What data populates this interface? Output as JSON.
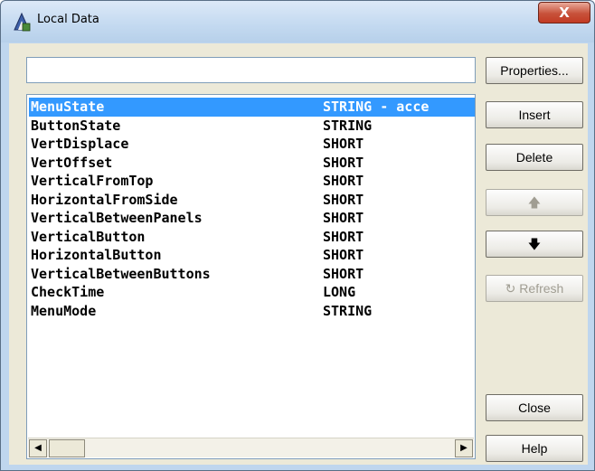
{
  "window": {
    "title": "Local Data",
    "close_label": "X"
  },
  "search": {
    "value": "",
    "placeholder": ""
  },
  "list": {
    "rows": [
      {
        "name": "MenuState",
        "type": "STRING - acce",
        "selected": true
      },
      {
        "name": "ButtonState",
        "type": "STRING"
      },
      {
        "name": "VertDisplace",
        "type": "SHORT"
      },
      {
        "name": "VertOffset",
        "type": "SHORT"
      },
      {
        "name": "VerticalFromTop",
        "type": "SHORT"
      },
      {
        "name": "HorizontalFromSide",
        "type": "SHORT"
      },
      {
        "name": "VerticalBetweenPanels",
        "type": "SHORT"
      },
      {
        "name": "VerticalButton",
        "type": "SHORT"
      },
      {
        "name": "HorizontalButton",
        "type": "SHORT"
      },
      {
        "name": "VerticalBetweenButtons",
        "type": "SHORT"
      },
      {
        "name": "CheckTime",
        "type": "LONG"
      },
      {
        "name": "MenuMode",
        "type": "STRING"
      }
    ],
    "selected_color": "#3399ff"
  },
  "scrollbar": {
    "left_icon": "triangle-left-icon",
    "right_icon": "triangle-right-icon",
    "left_glyph": "◀",
    "right_glyph": "▶"
  },
  "buttons": {
    "properties": "Properties...",
    "insert": "Insert",
    "delete": "Delete",
    "move_up_glyph": "🡅",
    "move_down_glyph": "🡇",
    "refresh": "Refresh",
    "refresh_glyph": "↻",
    "close": "Close",
    "help": "Help"
  }
}
